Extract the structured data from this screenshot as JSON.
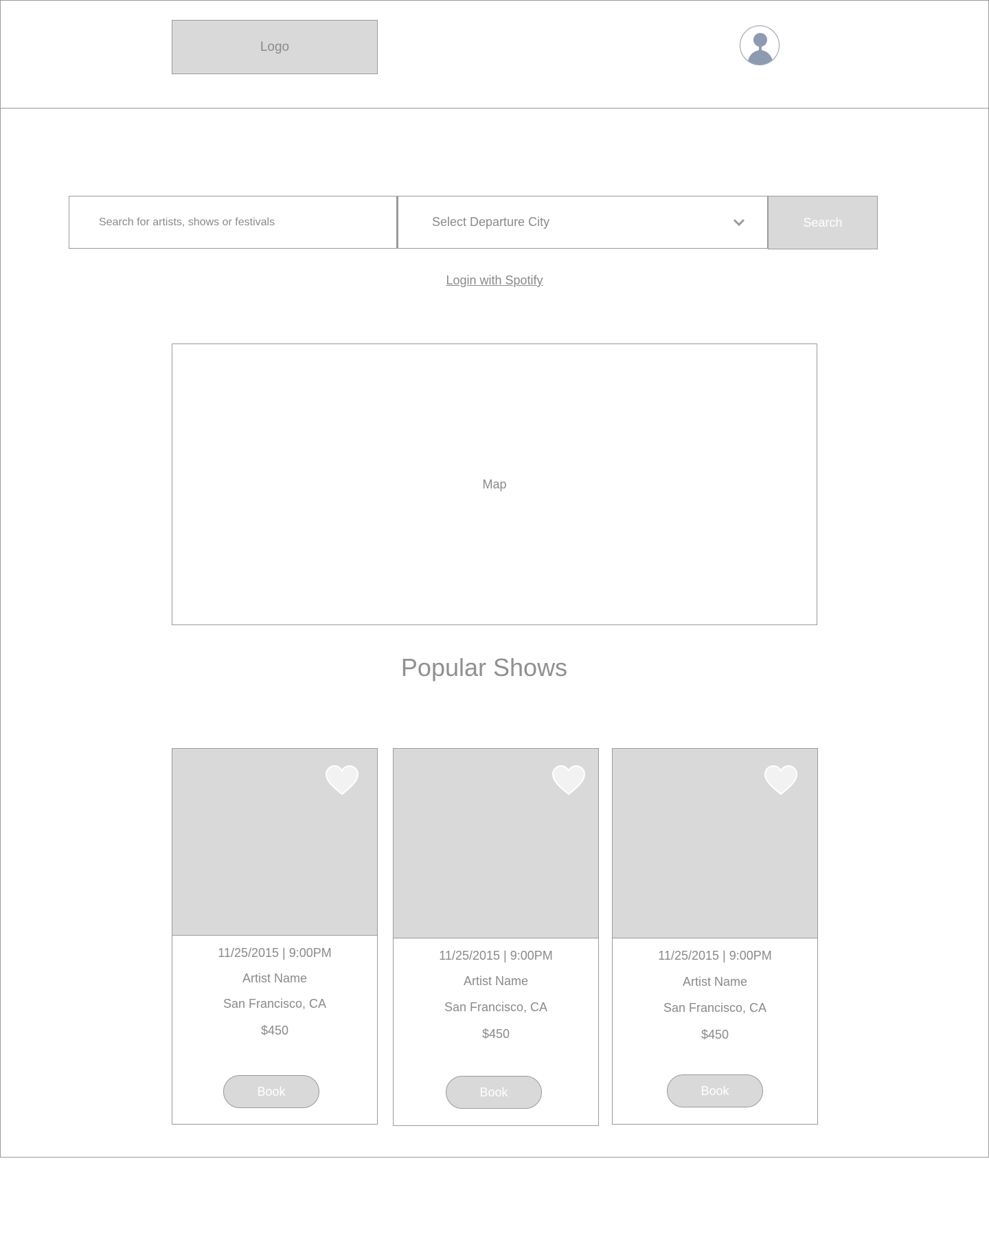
{
  "header": {
    "logo_label": "Logo",
    "avatar_icon": "user-avatar-icon"
  },
  "search": {
    "placeholder": "Search for artists, shows or festivals",
    "city_placeholder": "Select Departure City",
    "button_label": "Search"
  },
  "login_link": "Login with Spotify",
  "map_label": "Map",
  "popular": {
    "title": "Popular Shows",
    "cards": [
      {
        "datetime": "11/25/2015 | 9:00PM",
        "artist": "Artist Name",
        "location": "San Francisco, CA",
        "price": "$450",
        "book_label": "Book"
      },
      {
        "datetime": "11/25/2015 | 9:00PM",
        "artist": "Artist Name",
        "location": "San Francisco, CA",
        "price": "$450",
        "book_label": "Book"
      },
      {
        "datetime": "11/25/2015 | 9:00PM",
        "artist": "Artist Name",
        "location": "San Francisco, CA",
        "price": "$450",
        "book_label": "Book"
      }
    ]
  },
  "colors": {
    "placeholder_fill": "#d9d9d9",
    "border": "#9a9a9a",
    "text": "#8a8a8a",
    "avatar": "#8d9bb1"
  }
}
